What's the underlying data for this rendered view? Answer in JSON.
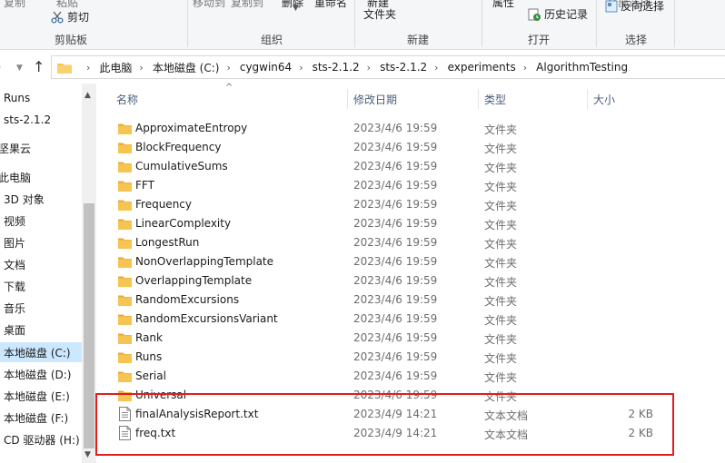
{
  "ribbon": {
    "clipboard": {
      "top_left_label": "复制",
      "top_mid_label": "粘贴",
      "cut_label": "剪切",
      "group_label": "剪贴板"
    },
    "organize": {
      "move_to": "移动到",
      "copy_to": "复制到",
      "delete": "删除",
      "rename": "重命名",
      "group_label": "组织"
    },
    "new": {
      "top_label": "新建",
      "new_folder": "文件夹",
      "group_label": "新建"
    },
    "open": {
      "properties": "属性",
      "history": "历史记录",
      "group_label": "打开"
    },
    "select": {
      "top_label": "全部选择",
      "invert": "反向选择",
      "group_label": "选择"
    }
  },
  "address": {
    "crumbs": [
      "此电脑",
      "本地磁盘 (C:)",
      "cygwin64",
      "sts-2.1.2",
      "sts-2.1.2",
      "experiments",
      "AlgorithmTesting"
    ]
  },
  "sidebar": {
    "items": [
      {
        "label": "Runs",
        "selected": false
      },
      {
        "label": "sts-2.1.2",
        "selected": false
      },
      {
        "label": "坚果云",
        "selected": false
      },
      {
        "label": "此电脑",
        "selected": false
      },
      {
        "label": "3D 对象",
        "selected": false
      },
      {
        "label": "视频",
        "selected": false
      },
      {
        "label": "图片",
        "selected": false
      },
      {
        "label": "文档",
        "selected": false
      },
      {
        "label": "下载",
        "selected": false
      },
      {
        "label": "音乐",
        "selected": false
      },
      {
        "label": "桌面",
        "selected": false
      },
      {
        "label": "本地磁盘 (C:)",
        "selected": true
      },
      {
        "label": "本地磁盘 (D:)",
        "selected": false
      },
      {
        "label": "本地磁盘 (E:)",
        "selected": false
      },
      {
        "label": "本地磁盘 (F:)",
        "selected": false
      },
      {
        "label": "CD 驱动器 (H:)",
        "selected": false
      }
    ]
  },
  "columns": {
    "name": "名称",
    "date": "修改日期",
    "type": "类型",
    "size": "大小"
  },
  "files": [
    {
      "name": "ApproximateEntropy",
      "date": "2023/4/6 19:59",
      "type": "文件夹",
      "size": "",
      "kind": "folder"
    },
    {
      "name": "BlockFrequency",
      "date": "2023/4/6 19:59",
      "type": "文件夹",
      "size": "",
      "kind": "folder"
    },
    {
      "name": "CumulativeSums",
      "date": "2023/4/6 19:59",
      "type": "文件夹",
      "size": "",
      "kind": "folder"
    },
    {
      "name": "FFT",
      "date": "2023/4/6 19:59",
      "type": "文件夹",
      "size": "",
      "kind": "folder"
    },
    {
      "name": "Frequency",
      "date": "2023/4/6 19:59",
      "type": "文件夹",
      "size": "",
      "kind": "folder"
    },
    {
      "name": "LinearComplexity",
      "date": "2023/4/6 19:59",
      "type": "文件夹",
      "size": "",
      "kind": "folder"
    },
    {
      "name": "LongestRun",
      "date": "2023/4/6 19:59",
      "type": "文件夹",
      "size": "",
      "kind": "folder"
    },
    {
      "name": "NonOverlappingTemplate",
      "date": "2023/4/6 19:59",
      "type": "文件夹",
      "size": "",
      "kind": "folder"
    },
    {
      "name": "OverlappingTemplate",
      "date": "2023/4/6 19:59",
      "type": "文件夹",
      "size": "",
      "kind": "folder"
    },
    {
      "name": "RandomExcursions",
      "date": "2023/4/6 19:59",
      "type": "文件夹",
      "size": "",
      "kind": "folder"
    },
    {
      "name": "RandomExcursionsVariant",
      "date": "2023/4/6 19:59",
      "type": "文件夹",
      "size": "",
      "kind": "folder"
    },
    {
      "name": "Rank",
      "date": "2023/4/6 19:59",
      "type": "文件夹",
      "size": "",
      "kind": "folder"
    },
    {
      "name": "Runs",
      "date": "2023/4/6 19:59",
      "type": "文件夹",
      "size": "",
      "kind": "folder"
    },
    {
      "name": "Serial",
      "date": "2023/4/6 19:59",
      "type": "文件夹",
      "size": "",
      "kind": "folder"
    },
    {
      "name": "Universal",
      "date": "2023/4/6 19:59",
      "type": "文件夹",
      "size": "",
      "kind": "folder"
    },
    {
      "name": "finalAnalysisReport.txt",
      "date": "2023/4/9 14:21",
      "type": "文本文档",
      "size": "2 KB",
      "kind": "file"
    },
    {
      "name": "freq.txt",
      "date": "2023/4/9 14:21",
      "type": "文本文档",
      "size": "2 KB",
      "kind": "file"
    }
  ],
  "colors": {
    "folder": "#f5c451",
    "folder_dark": "#e6a93a",
    "selected": "#cce8ff",
    "highlight": "#e01e1e"
  }
}
